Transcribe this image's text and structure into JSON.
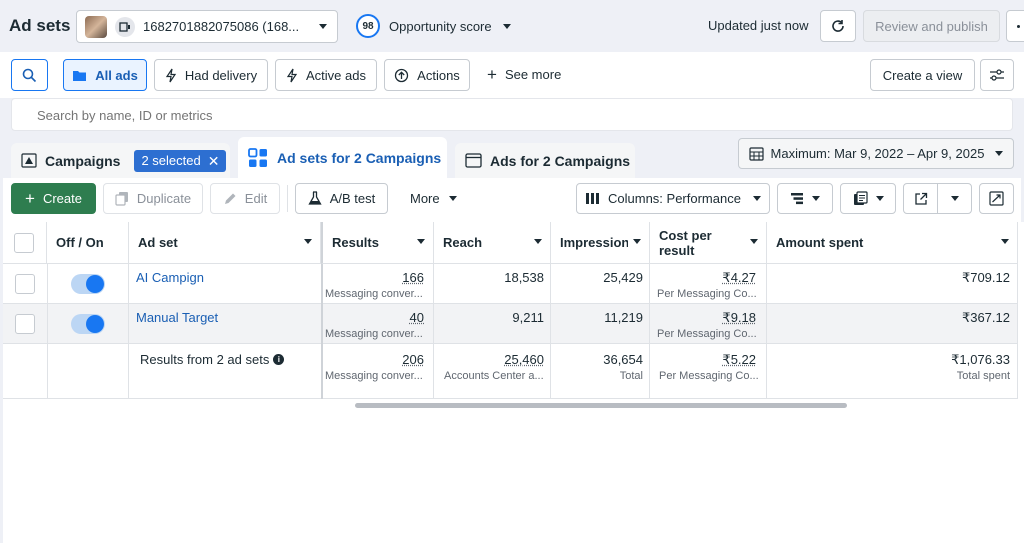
{
  "header": {
    "title": "Ad sets",
    "account_label": "1682701882075086 (168...",
    "score_value": "98",
    "score_label": "Opportunity score",
    "updated": "Updated just now",
    "review_label": "Review and publish"
  },
  "filters": {
    "all_ads": "All ads",
    "had_delivery": "Had delivery",
    "active_ads": "Active ads",
    "actions": "Actions",
    "see_more": "See more",
    "create_view": "Create a view"
  },
  "search": {
    "placeholder": "Search by name, ID or metrics"
  },
  "tabs": {
    "campaigns": "Campaigns",
    "selected": "2 selected",
    "adsets": "Ad sets for 2 Campaigns",
    "ads": "Ads for 2 Campaigns",
    "date_range": "Maximum: Mar 9, 2022 – Apr 9, 2025"
  },
  "toolbar": {
    "create": "Create",
    "duplicate": "Duplicate",
    "edit": "Edit",
    "ab_test": "A/B test",
    "more": "More",
    "columns": "Columns: Performance"
  },
  "table": {
    "headers": {
      "off_on": "Off / On",
      "ad_set": "Ad set",
      "results": "Results",
      "reach": "Reach",
      "impressions": "Impressions",
      "cost_per_result": "Cost per result",
      "amount_spent": "Amount spent"
    },
    "rows": [
      {
        "name": "AI Campign",
        "results": "166",
        "results_sub": "Messaging conver...",
        "reach": "18,538",
        "impressions": "25,429",
        "cost": "₹4.27",
        "cost_sub": "Per Messaging Co...",
        "spent": "₹709.12",
        "on": true
      },
      {
        "name": "Manual Target",
        "results": "40",
        "results_sub": "Messaging conver...",
        "reach": "9,211",
        "impressions": "11,219",
        "cost": "₹9.18",
        "cost_sub": "Per Messaging Co...",
        "spent": "₹367.12",
        "on": true
      }
    ],
    "totals": {
      "label": "Results from 2 ad sets",
      "results": "206",
      "results_sub": "Messaging conver...",
      "reach": "25,460",
      "reach_sub": "Accounts Center a...",
      "impressions": "36,654",
      "impressions_sub": "Total",
      "cost": "₹5.22",
      "cost_sub": "Per Messaging Co...",
      "spent": "₹1,076.33",
      "spent_sub": "Total spent"
    }
  },
  "colors": {
    "accent": "#1877f2",
    "create_green": "#2e7d4f",
    "link": "#1a5fb4"
  }
}
